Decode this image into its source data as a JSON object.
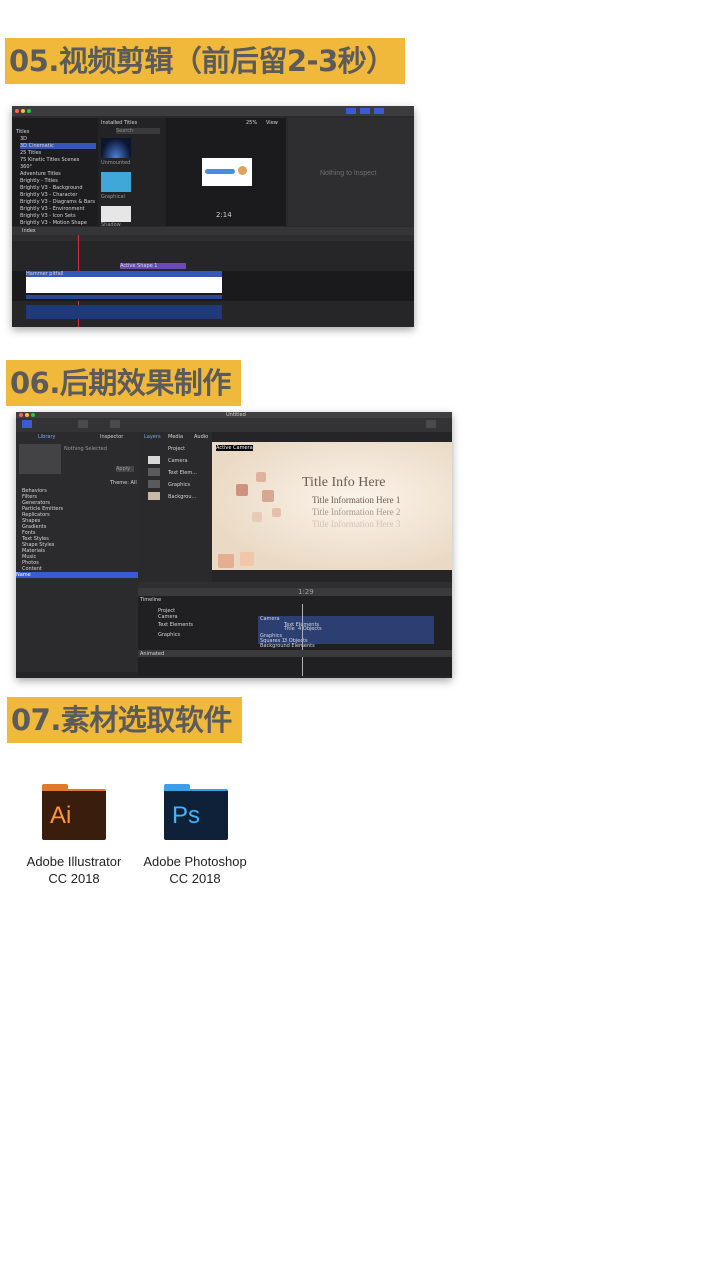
{
  "sections": {
    "s05": {
      "title": "05.视频剪辑（前后留2-3秒）"
    },
    "s06": {
      "title": "06.后期效果制作"
    },
    "s07": {
      "title": "07.素材选取软件"
    }
  },
  "fcp": {
    "library_items": [
      "Titles",
      "3D",
      "3D Cinematic",
      "25 Titles",
      "75 Kinetic Titles Scenes",
      "360°",
      "Adventure Titles",
      "Brightly - Titles",
      "Brightly V3 - Background",
      "Brightly V3 - Character",
      "Brightly V3 - Diagrams & Bars",
      "Brightly V3 - Environment",
      "Brightly V3 - Icon Sets",
      "Brightly V3 - Motion Shape"
    ],
    "browser_header": "Installed Titles",
    "search_placeholder": "Search",
    "thumb_labels": [
      "Unmounted",
      "Graphical",
      "Shadow"
    ],
    "viewer_zoom": "25%",
    "viewer_view": "View",
    "inspector_text": "Nothing to Inspect",
    "timecode": "2:14",
    "index_tab": "Index",
    "clip_titled": "Active Shape 1",
    "clip_main": "Hammer pitfall"
  },
  "motion": {
    "window_title": "Untitled",
    "left_tabs": [
      "Library",
      "Inspector"
    ],
    "nothing_selected": "Nothing Selected",
    "theme": "Theme: All",
    "apply": "Apply",
    "categories": [
      "Behaviors",
      "Filters",
      "Generators",
      "Particle Emitters",
      "Replicators",
      "Shapes",
      "Gradients",
      "Fonts",
      "Text Styles",
      "Shape Styles",
      "Materials",
      "Music",
      "Photos",
      "Content"
    ],
    "name_label": "Name",
    "layer_tabs": [
      "Layers",
      "Media",
      "Audio"
    ],
    "layers": [
      "Project",
      "Camera",
      "Text Elem...",
      "Graphics",
      "Backgrou..."
    ],
    "active_camera": "Active Camera",
    "canvas_title": "Title Info Here",
    "canvas_lines": [
      "Title Information Here 1",
      "Title Information Here 2",
      "Title Information Here 3"
    ],
    "timecode": "1:29",
    "timeline_label": "Timeline",
    "timeline_layers": [
      "Project",
      "Camera",
      "Text Elements",
      "Graphics"
    ],
    "timeline_tracks": [
      "Camera",
      "Text Elements",
      "Title",
      "Graphics",
      "Squares 1",
      "Background Elements"
    ],
    "objects_label": "4 Objects",
    "objects_label2": "3 Objects",
    "animated": "Animated"
  },
  "apps": [
    {
      "icon_text": "Ai",
      "name_line1": "Adobe Illustrator",
      "name_line2": "CC 2018",
      "tab_color": "#e07a2a",
      "body_color": "#3a1d0c",
      "text_color": "#ff9a30"
    },
    {
      "icon_text": "Ps",
      "name_line1": "Adobe Photoshop",
      "name_line2": "CC 2018",
      "tab_color": "#3aa0e8",
      "body_color": "#0e2138",
      "text_color": "#41b4ff"
    }
  ]
}
